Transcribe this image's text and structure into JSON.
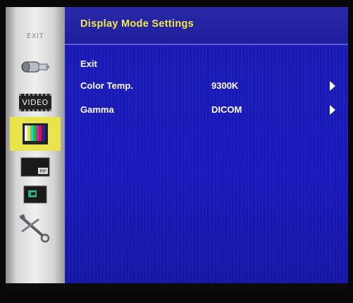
{
  "header": {
    "title": "Display  Mode Settings"
  },
  "sidebar": {
    "items": [
      {
        "id": "exit",
        "label": "EXIT",
        "icon": "exit-icon"
      },
      {
        "id": "input",
        "icon": "connector-icon"
      },
      {
        "id": "video",
        "label": "VIDEO",
        "icon": "video-icon"
      },
      {
        "id": "display-mode",
        "icon": "color-bars-icon",
        "selected": true
      },
      {
        "id": "pip",
        "label": "PIP",
        "icon": "pip-icon"
      },
      {
        "id": "screen",
        "icon": "screen-icon"
      },
      {
        "id": "tools",
        "icon": "tools-icon"
      }
    ]
  },
  "menu": {
    "rows": [
      {
        "label": "Exit",
        "value": "",
        "has_arrow": false
      },
      {
        "label": "Color Temp.",
        "value": "9300K",
        "has_arrow": true
      },
      {
        "label": "Gamma",
        "value": "DICOM",
        "has_arrow": true
      }
    ]
  },
  "colors": {
    "panel_blue": "#1a1ab8",
    "title_yellow": "#f3ea4a",
    "selection_yellow": "#e9e44a"
  }
}
